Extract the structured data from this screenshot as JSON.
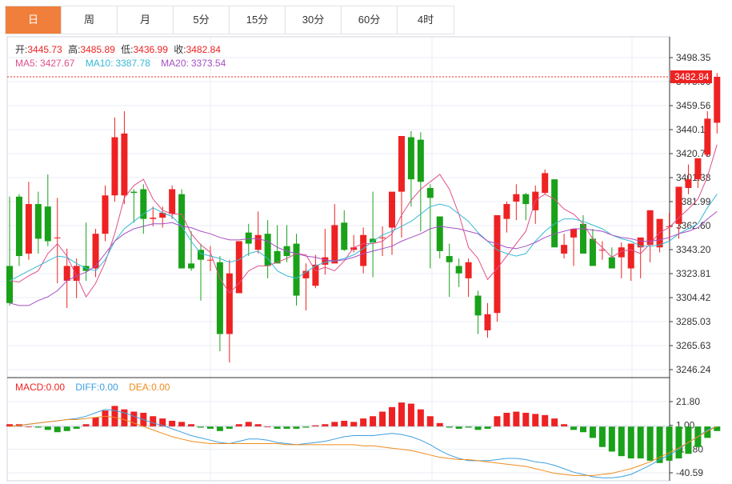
{
  "tabs": [
    {
      "label": "日",
      "active": true
    },
    {
      "label": "周",
      "active": false
    },
    {
      "label": "月",
      "active": false
    },
    {
      "label": "5分",
      "active": false
    },
    {
      "label": "15分",
      "active": false
    },
    {
      "label": "30分",
      "active": false
    },
    {
      "label": "60分",
      "active": false
    },
    {
      "label": "4时",
      "active": false
    }
  ],
  "colors": {
    "up": "#ee2222",
    "down": "#1aa11a",
    "ma5": "#e0508c",
    "ma10": "#37b9d6",
    "ma20": "#a64fc4",
    "dea": "#f08c1e",
    "diff": "#3da0e0",
    "grid": "#e8eef3",
    "axis": "#333333",
    "price_line": "#ee2222"
  },
  "ohlc_info": {
    "open_label": "开:",
    "open": "3445.73",
    "high_label": "高:",
    "high": "3485.89",
    "low_label": "低:",
    "low": "3436.99",
    "close_label": "收:",
    "close": "3482.84"
  },
  "ma_info": {
    "ma5_label": "MA5:",
    "ma5": "3427.67",
    "ma10_label": "MA10:",
    "ma10": "3387.78",
    "ma20_label": "MA20:",
    "ma20": "3373.54"
  },
  "macd_info": {
    "macd_label": "MACD:",
    "macd": "0.00",
    "diff_label": "DIFF:",
    "diff": "0.00",
    "dea_label": "DEA:",
    "dea": "0.00"
  },
  "chart_data": {
    "type": "candlestick",
    "last_price": "3482.84",
    "price_axis_ticks": [
      "3498.35",
      "3478.96",
      "3459.56",
      "3440.17",
      "3420.78",
      "3401.38",
      "3381.99",
      "3362.60",
      "3343.20",
      "3323.81",
      "3304.42",
      "3285.03",
      "3265.63",
      "3246.24"
    ],
    "price_range": [
      3246.24,
      3498.35
    ],
    "macd_axis_ticks": [
      "21.80",
      "1.00",
      "-19.80",
      "-40.59"
    ],
    "macd_range": [
      -40.59,
      21.8
    ],
    "candles": [
      [
        3330,
        3386,
        3298,
        3300
      ],
      [
        3386,
        3388,
        3330,
        3338
      ],
      [
        3340,
        3398,
        3335,
        3380
      ],
      [
        3380,
        3390,
        3340,
        3352
      ],
      [
        3378,
        3404,
        3346,
        3350
      ],
      [
        3353,
        3385,
        3316,
        3353
      ],
      [
        3318,
        3344,
        3296,
        3330
      ],
      [
        3318,
        3336,
        3304,
        3330
      ],
      [
        3330,
        3365,
        3318,
        3326
      ],
      [
        3328,
        3360,
        3321,
        3356
      ],
      [
        3356,
        3395,
        3350,
        3387
      ],
      [
        3387,
        3450,
        3382,
        3434
      ],
      [
        3387,
        3455,
        3380,
        3437
      ],
      [
        3390,
        3392,
        3365,
        3389
      ],
      [
        3392,
        3396,
        3356,
        3368
      ],
      [
        3368,
        3378,
        3362,
        3369
      ],
      [
        3369,
        3378,
        3361,
        3373
      ],
      [
        3372,
        3395,
        3368,
        3392
      ],
      [
        3388,
        3392,
        3340,
        3328
      ],
      [
        3332,
        3358,
        3326,
        3328
      ],
      [
        3343,
        3348,
        3302,
        3335
      ],
      [
        3335,
        3346,
        3326,
        3335
      ],
      [
        3333,
        3338,
        3261,
        3275
      ],
      [
        3275,
        3335,
        3252,
        3324
      ],
      [
        3308,
        3350,
        3308,
        3350
      ],
      [
        3357,
        3364,
        3338,
        3348
      ],
      [
        3343,
        3374,
        3340,
        3355
      ],
      [
        3356,
        3367,
        3320,
        3330
      ],
      [
        3342,
        3363,
        3333,
        3332
      ],
      [
        3346,
        3363,
        3333,
        3338
      ],
      [
        3348,
        3356,
        3298,
        3306
      ],
      [
        3320,
        3332,
        3294,
        3326
      ],
      [
        3314,
        3339,
        3312,
        3331
      ],
      [
        3331,
        3360,
        3323,
        3337
      ],
      [
        3332,
        3380,
        3340,
        3363
      ],
      [
        3365,
        3375,
        3342,
        3343
      ],
      [
        3343,
        3355,
        3341,
        3345
      ],
      [
        3330,
        3361,
        3324,
        3355
      ],
      [
        3352,
        3390,
        3321,
        3349
      ],
      [
        3353,
        3362,
        3338,
        3353
      ],
      [
        3361,
        3384,
        3339,
        3390
      ],
      [
        3390,
        3429,
        3353,
        3435
      ],
      [
        3434,
        3439,
        3378,
        3400
      ],
      [
        3432,
        3438,
        3358,
        3398
      ],
      [
        3393,
        3396,
        3328,
        3385
      ],
      [
        3370,
        3362,
        3336,
        3342
      ],
      [
        3338,
        3348,
        3305,
        3333
      ],
      [
        3330,
        3336,
        3313,
        3324
      ],
      [
        3320,
        3336,
        3305,
        3333
      ],
      [
        3306,
        3310,
        3275,
        3290
      ],
      [
        3278,
        3300,
        3272,
        3291
      ],
      [
        3292,
        3368,
        3285,
        3371
      ],
      [
        3368,
        3382,
        3357,
        3380
      ],
      [
        3382,
        3396,
        3367,
        3388
      ],
      [
        3388,
        3389,
        3367,
        3380
      ],
      [
        3375,
        3395,
        3364,
        3390
      ],
      [
        3389,
        3408,
        3388,
        3405
      ],
      [
        3400,
        3400,
        3346,
        3345
      ],
      [
        3340,
        3356,
        3336,
        3347
      ],
      [
        3353,
        3358,
        3330,
        3360
      ],
      [
        3364,
        3371,
        3340,
        3340
      ],
      [
        3352,
        3360,
        3334,
        3330
      ],
      [
        3343,
        3350,
        3335,
        3343
      ],
      [
        3337,
        3345,
        3328,
        3328
      ],
      [
        3337,
        3349,
        3320,
        3345
      ],
      [
        3328,
        3348,
        3318,
        3348
      ],
      [
        3345,
        3352,
        3320,
        3353
      ],
      [
        3347,
        3358,
        3333,
        3375
      ],
      [
        3345,
        3363,
        3341,
        3368
      ],
      [
        3362,
        3373,
        3350,
        3362
      ],
      [
        3364,
        3392,
        3352,
        3394
      ],
      [
        3393,
        3412,
        3388,
        3400
      ],
      [
        3400,
        3417,
        3393,
        3417
      ],
      [
        3420,
        3455,
        3418,
        3449
      ],
      [
        3445.73,
        3485.89,
        3436.99,
        3482.84
      ]
    ],
    "ma5": [
      3318,
      3317,
      3322,
      3326,
      3340,
      3348,
      3338,
      3322,
      3305,
      3316,
      3333,
      3356,
      3385,
      3395,
      3400,
      3384,
      3375,
      3372,
      3372,
      3356,
      3347,
      3341,
      3320,
      3308,
      3316,
      3326,
      3330,
      3330,
      3333,
      3336,
      3340,
      3339,
      3326,
      3329,
      3326,
      3334,
      3345,
      3348,
      3348,
      3350,
      3356,
      3371,
      3383,
      3392,
      3398,
      3404,
      3392,
      3372,
      3345,
      3336,
      3319,
      3328,
      3338,
      3348,
      3358,
      3383,
      3388,
      3384,
      3376,
      3372,
      3364,
      3352,
      3345,
      3337,
      3342,
      3343,
      3340,
      3348,
      3357,
      3361,
      3369,
      3376,
      3384,
      3402,
      3428
    ],
    "ma10": [
      3318,
      3322,
      3326,
      3330,
      3334,
      3338,
      3337,
      3332,
      3328,
      3326,
      3335,
      3350,
      3360,
      3366,
      3372,
      3377,
      3373,
      3370,
      3362,
      3350,
      3340,
      3338,
      3336,
      3333,
      3335,
      3340,
      3342,
      3336,
      3326,
      3322,
      3320,
      3325,
      3330,
      3333,
      3334,
      3336,
      3339,
      3344,
      3350,
      3355,
      3358,
      3362,
      3366,
      3372,
      3378,
      3380,
      3378,
      3372,
      3366,
      3357,
      3350,
      3343,
      3340,
      3338,
      3340,
      3350,
      3358,
      3364,
      3368,
      3368,
      3366,
      3363,
      3360,
      3355,
      3352,
      3350,
      3346,
      3346,
      3347,
      3350,
      3356,
      3360,
      3364,
      3377,
      3388
    ],
    "ma20": [
      3300,
      3298,
      3298,
      3302,
      3305,
      3310,
      3318,
      3322,
      3325,
      3330,
      3340,
      3350,
      3356,
      3360,
      3362,
      3364,
      3364,
      3365,
      3362,
      3361,
      3358,
      3356,
      3353,
      3351,
      3351,
      3352,
      3352,
      3350,
      3345,
      3342,
      3340,
      3338,
      3337,
      3335,
      3334,
      3335,
      3337,
      3340,
      3342,
      3344,
      3346,
      3350,
      3353,
      3356,
      3360,
      3362,
      3361,
      3360,
      3358,
      3356,
      3350,
      3348,
      3345,
      3344,
      3346,
      3349,
      3353,
      3356,
      3358,
      3360,
      3360,
      3359,
      3358,
      3355,
      3353,
      3352,
      3350,
      3350,
      3351,
      3353,
      3356,
      3358,
      3361,
      3368,
      3374
    ],
    "macd": [
      2,
      2,
      0,
      -1,
      -3,
      -5,
      -4,
      -2,
      2,
      8,
      14,
      18,
      15,
      13,
      12,
      9,
      7,
      5,
      4,
      2,
      -1,
      -2,
      -4,
      -2,
      2,
      4,
      2,
      0,
      -2,
      -2,
      -2,
      -1,
      1,
      2,
      4,
      5,
      4,
      7,
      9,
      13,
      17,
      21,
      20,
      15,
      9,
      3,
      -1,
      -2,
      -1,
      -3,
      -2,
      9,
      12,
      13,
      12,
      11,
      10,
      7,
      2,
      -3,
      -5,
      -10,
      -18,
      -22,
      -26,
      -28,
      -28,
      -30,
      -32,
      -30,
      -28,
      -24,
      -18,
      -10,
      -4
    ],
    "diff": [
      0,
      1,
      2,
      3,
      4,
      5,
      6,
      7,
      9,
      12,
      15,
      14,
      12,
      9,
      6,
      3,
      1,
      -2,
      -5,
      -8,
      -10,
      -12,
      -14,
      -15,
      -13,
      -11,
      -11,
      -12,
      -14,
      -15,
      -16,
      -15,
      -14,
      -13,
      -11,
      -9,
      -8,
      -8,
      -8,
      -7,
      -6,
      -7,
      -9,
      -12,
      -16,
      -21,
      -25,
      -28,
      -30,
      -30,
      -30,
      -29,
      -28,
      -28,
      -29,
      -31,
      -32,
      -34,
      -37,
      -40,
      -42,
      -44,
      -45,
      -45,
      -44,
      -42,
      -38,
      -34,
      -29,
      -25,
      -20,
      -14,
      -9,
      -3,
      0
    ],
    "dea": [
      0,
      1,
      2,
      3,
      4,
      5,
      6,
      6,
      7,
      8,
      9,
      8,
      6,
      3,
      0,
      -3,
      -6,
      -9,
      -11,
      -13,
      -14,
      -15,
      -15,
      -15,
      -15,
      -15,
      -15,
      -15,
      -15,
      -16,
      -16,
      -16,
      -16,
      -16,
      -16,
      -16,
      -16,
      -17,
      -17,
      -18,
      -19,
      -20,
      -21,
      -23,
      -25,
      -27,
      -28,
      -29,
      -29,
      -30,
      -31,
      -32,
      -33,
      -34,
      -35,
      -37,
      -39,
      -41,
      -42,
      -43,
      -43,
      -43,
      -42,
      -41,
      -39,
      -37,
      -34,
      -31,
      -27,
      -23,
      -19,
      -14,
      -9,
      -4,
      0
    ]
  }
}
